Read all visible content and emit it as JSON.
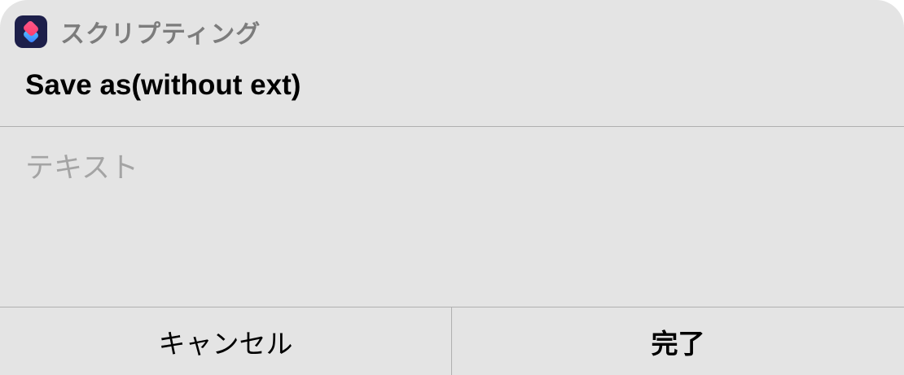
{
  "app": {
    "name": "スクリプティング",
    "icon": "shortcuts-app-icon"
  },
  "dialog": {
    "title": "Save as(without ext)",
    "input": {
      "value": "",
      "placeholder": "テキスト"
    },
    "buttons": {
      "cancel_label": "キャンセル",
      "done_label": "完了"
    }
  },
  "colors": {
    "background": "#e4e4e4",
    "divider": "#b0b0b0",
    "app_name": "#7c7c7c",
    "placeholder": "#a4a4a4"
  }
}
